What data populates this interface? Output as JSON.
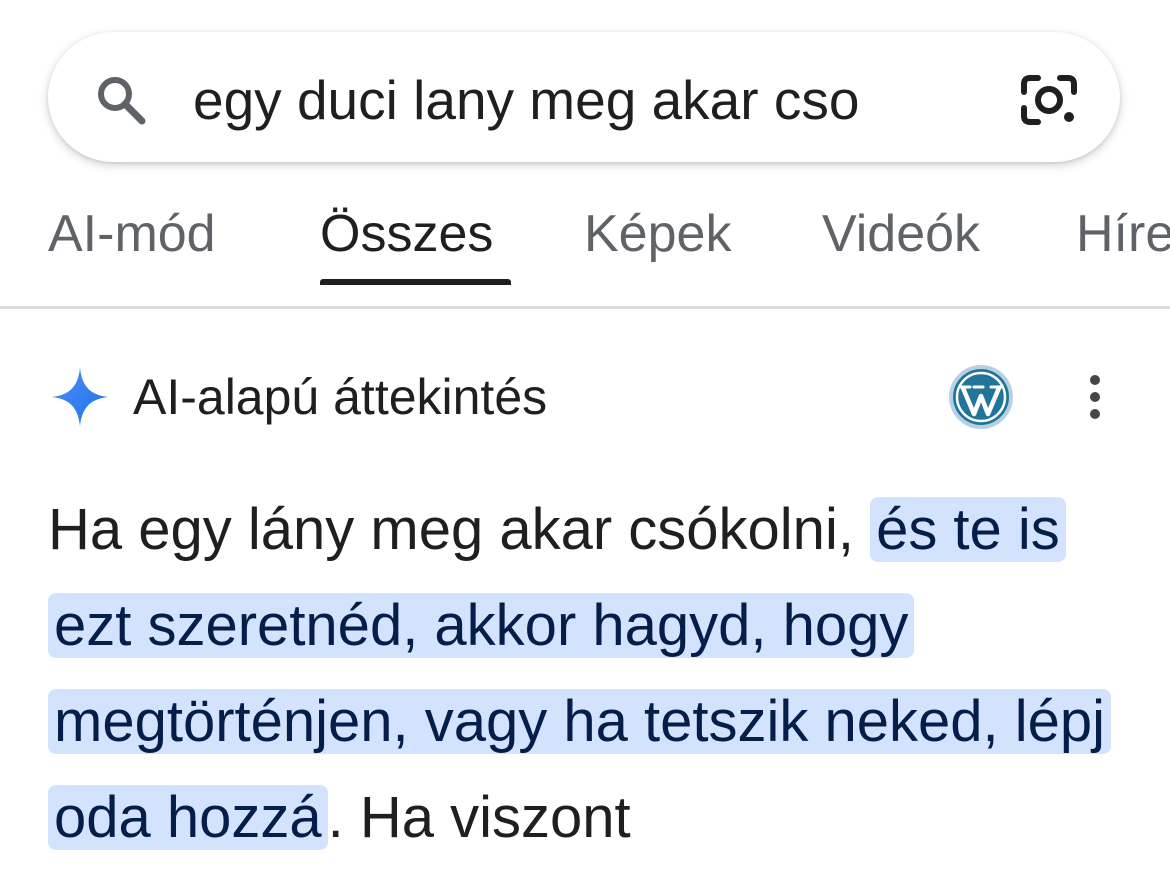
{
  "search": {
    "query": "egy duci lany meg akar cso"
  },
  "tabs": [
    {
      "label": "AI-mód",
      "active": false
    },
    {
      "label": "Összes",
      "active": true
    },
    {
      "label": "Képek",
      "active": false
    },
    {
      "label": "Videók",
      "active": false
    },
    {
      "label": "Híre",
      "active": false
    }
  ],
  "ai_overview": {
    "title": "AI-alapú áttekintés",
    "source_icon": "wordpress-icon",
    "text_before": "Ha egy lány meg akar csókolni, ",
    "text_highlighted": "és te is ezt szeretnéd, akkor hagyd, hogy megtörténjen, vagy ha tetszik neked, lépj oda hozzá",
    "text_after": ". Ha viszont"
  },
  "colors": {
    "highlight_bg": "#d3e3fd",
    "highlight_text": "#041e49",
    "tab_inactive": "#5f6368",
    "sparkle_blue": "#4285f4"
  }
}
